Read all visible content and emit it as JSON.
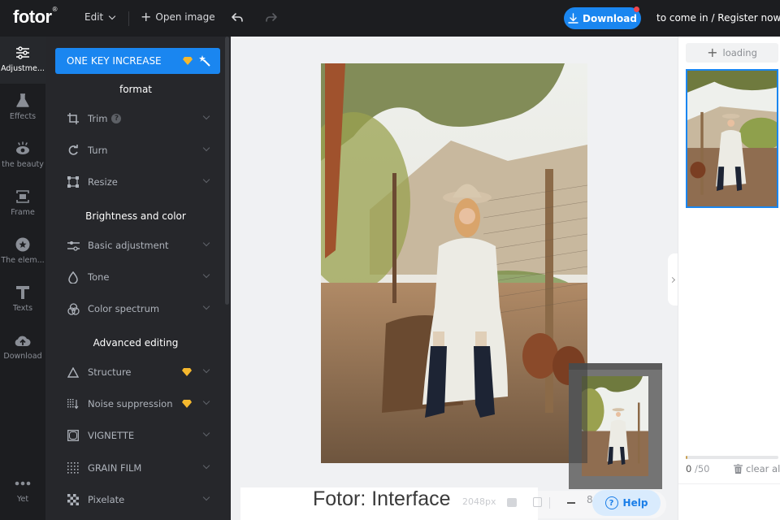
{
  "topbar": {
    "logo": "fotor",
    "logo_mark": "®",
    "edit_menu": "Edit",
    "open_image": "Open image",
    "download": "Download",
    "login": "to come in / Register now"
  },
  "rail": {
    "items": [
      {
        "label": "Adjustme...",
        "icon": "sliders-icon",
        "active": true
      },
      {
        "label": "Effects",
        "icon": "flask-icon"
      },
      {
        "label": "the beauty",
        "icon": "eye-icon"
      },
      {
        "label": "Frame",
        "icon": "frame-icon"
      },
      {
        "label": "The elem...",
        "icon": "star-circle-icon"
      },
      {
        "label": "Texts",
        "icon": "text-icon"
      },
      {
        "label": "Download",
        "icon": "cloud-upload-icon"
      },
      {
        "label": "Yet",
        "icon": "more-icon"
      }
    ]
  },
  "panel": {
    "one_key": "ONE KEY INCREASE",
    "sections": {
      "format": "format",
      "brightness": "Brightness and color",
      "advanced": "Advanced editing"
    },
    "tools": {
      "trim": "Trim",
      "turn": "Turn",
      "resize": "Resize",
      "basic": "Basic adjustment",
      "tone": "Tone",
      "spectrum": "Color spectrum",
      "structure": "Structure",
      "noise": "Noise suppression",
      "vignette": "VIGNETTE",
      "grain": "GRAIN FILM",
      "pixelate": "Pixelate"
    },
    "help_mark": "?"
  },
  "canvas": {
    "caption": "Fotor: Interface",
    "size_text": "2048px",
    "zoom_text": "8",
    "help": "Help",
    "help_mark": "?"
  },
  "right": {
    "loading": "loading",
    "count": "0",
    "total": "/50",
    "clear_all": "clear all",
    "progress_fraction": 0.02
  },
  "colors": {
    "accent": "#1a86f0",
    "topbar_bg": "#1c1d20",
    "panel_bg": "#26272b",
    "premium_gem": "#f5b82e",
    "notification_dot": "#f0454c"
  }
}
